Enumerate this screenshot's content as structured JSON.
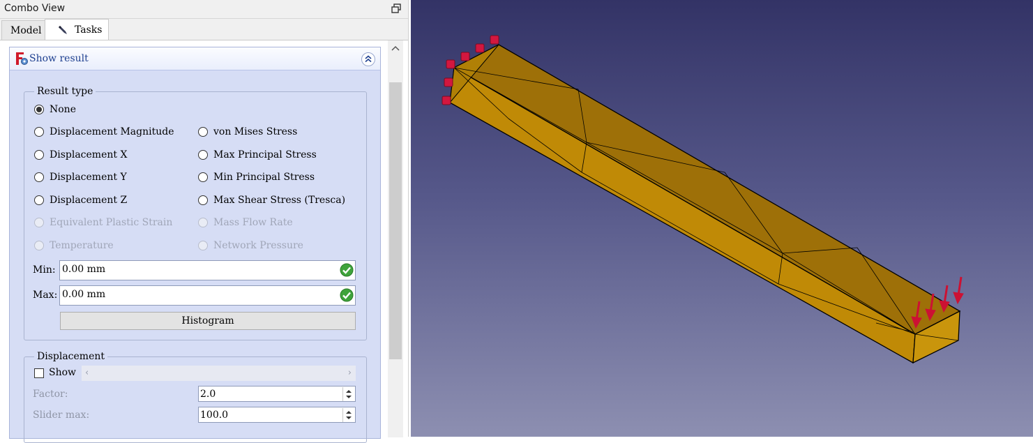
{
  "window": {
    "title": "Combo View"
  },
  "tabs": [
    {
      "label": "Model"
    },
    {
      "label": "Tasks"
    }
  ],
  "panel": {
    "title": "Show result",
    "result_type": {
      "legend": "Result type",
      "options_left": [
        {
          "label": "None",
          "selected": true,
          "enabled": true
        },
        {
          "label": "Displacement Magnitude",
          "selected": false,
          "enabled": true
        },
        {
          "label": "Displacement X",
          "selected": false,
          "enabled": true
        },
        {
          "label": "Displacement Y",
          "selected": false,
          "enabled": true
        },
        {
          "label": "Displacement Z",
          "selected": false,
          "enabled": true
        },
        {
          "label": "Equivalent Plastic Strain",
          "selected": false,
          "enabled": false
        },
        {
          "label": "Temperature",
          "selected": false,
          "enabled": false
        }
      ],
      "options_right": [
        {
          "label": "von Mises Stress",
          "selected": false,
          "enabled": true
        },
        {
          "label": "Max Principal Stress",
          "selected": false,
          "enabled": true
        },
        {
          "label": "Min Principal Stress",
          "selected": false,
          "enabled": true
        },
        {
          "label": "Max Shear Stress (Tresca)",
          "selected": false,
          "enabled": true
        },
        {
          "label": "Mass Flow Rate",
          "selected": false,
          "enabled": false
        },
        {
          "label": "Network Pressure",
          "selected": false,
          "enabled": false
        }
      ],
      "min_label": "Min:",
      "min_value": "0.00 mm",
      "max_label": "Max:",
      "max_value": "0.00 mm",
      "histogram_label": "Histogram"
    },
    "displacement": {
      "legend": "Displacement",
      "show_label": "Show",
      "show_checked": false,
      "factor_label": "Factor:",
      "factor_value": "2.0",
      "slider_max_label": "Slider max:",
      "slider_max_value": "100.0"
    }
  },
  "colors": {
    "panel_bg": "#d6ddf5",
    "viewport_top": "#333366",
    "viewport_bottom": "#8d8fb1",
    "beam_fill": "#c08a06",
    "constraint_color": "#d3173f",
    "load_arrow_color": "#cc1133"
  }
}
